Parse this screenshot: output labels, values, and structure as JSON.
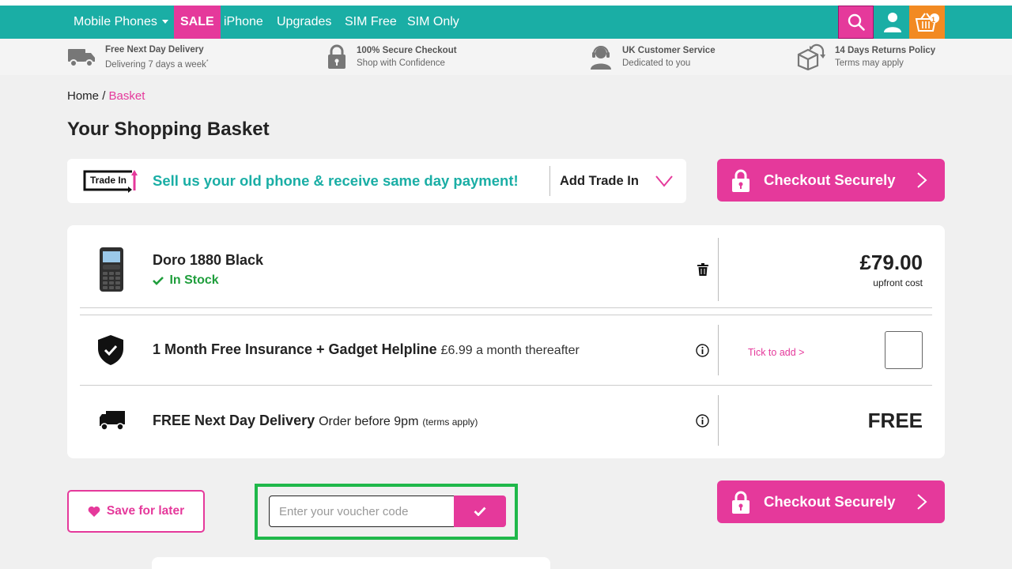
{
  "nav": {
    "items": [
      {
        "label": "Mobile Phones",
        "has_dropdown": true
      },
      {
        "label": "SALE",
        "highlight": true
      },
      {
        "label": "iPhone"
      },
      {
        "label": "Upgrades"
      },
      {
        "label": "SIM Free"
      },
      {
        "label": "SIM Only"
      }
    ],
    "icons": [
      "search-icon",
      "account-icon",
      "basket-icon"
    ],
    "basket_count": "1",
    "colors": {
      "bar": "#1aaea5",
      "sale": "#e5399b",
      "search": "#e5399b",
      "basket": "#f28a22"
    }
  },
  "benefits": [
    {
      "icon": "delivery-van-icon",
      "title": "Free Next Day Delivery",
      "subtitle": "Delivering 7 days a week",
      "sup": "*"
    },
    {
      "icon": "lock-icon",
      "title": "100% Secure Checkout",
      "subtitle": "Shop with Confidence"
    },
    {
      "icon": "headset-icon",
      "title": "UK Customer Service",
      "subtitle": "Dedicated to you"
    },
    {
      "icon": "return-box-icon",
      "title": "14 Days Returns Policy",
      "subtitle": "Terms may apply"
    }
  ],
  "breadcrumb": {
    "home": "Home",
    "separator": "/",
    "current": "Basket"
  },
  "page_title": "Your Shopping Basket",
  "trade_in": {
    "logo_text": "Trade In",
    "message": "Sell us your old phone & receive same day payment!",
    "add_label": "Add Trade In"
  },
  "checkout": {
    "label": "Checkout Securely"
  },
  "basket": {
    "product": {
      "name": "Doro 1880 Black",
      "stock": "In Stock",
      "price": "£79.00",
      "price_note": "upfront cost"
    },
    "insurance": {
      "title": "1 Month Free Insurance + Gadget Helpline",
      "detail": "£6.99 a month thereafter",
      "tick_label": "Tick to add >",
      "checked": false
    },
    "delivery": {
      "title": "FREE Next Day Delivery",
      "detail": "Order before 9pm",
      "note": "(terms apply)",
      "price": "FREE"
    }
  },
  "save_for_later": "Save for later",
  "voucher": {
    "placeholder": "Enter your voucher code",
    "value": ""
  },
  "colors": {
    "accent": "#e5399b",
    "teal": "#1aaea5",
    "stock_green": "#1f9e3c",
    "highlight_box": "#1fb84a"
  }
}
